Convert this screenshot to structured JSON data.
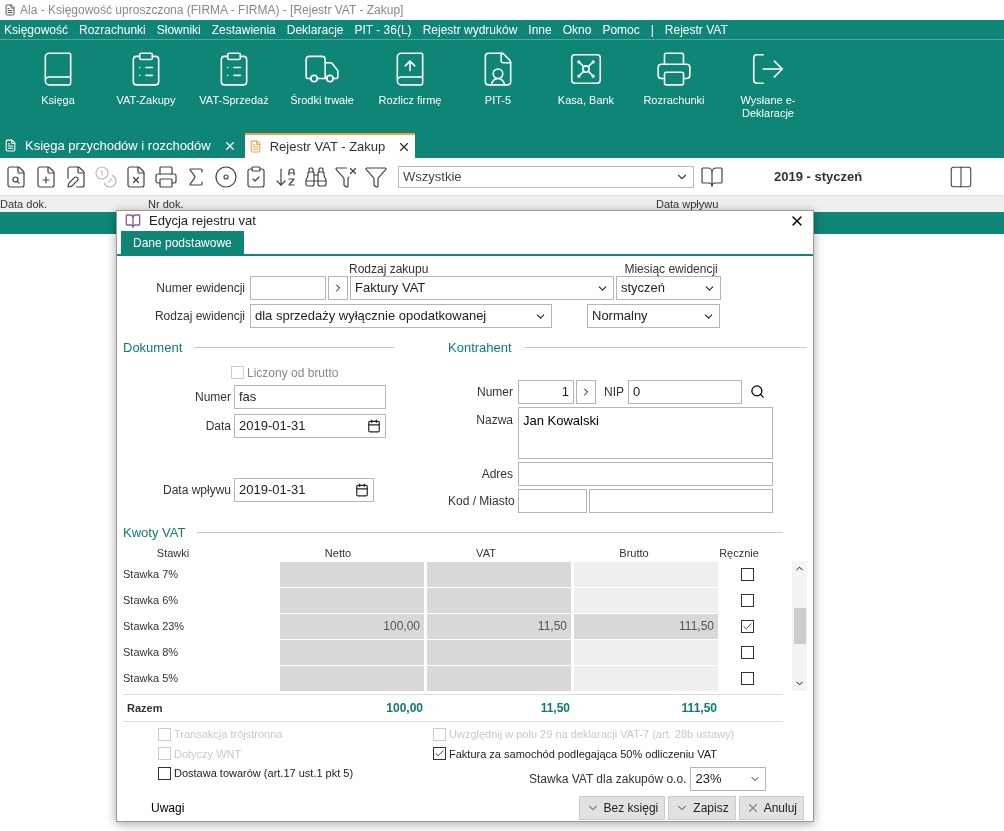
{
  "window": {
    "title": "Ala - Księgowość uproszczona (FIRMA - FIRMA) - [Rejestr VAT - Zakup]"
  },
  "menu": [
    "Księgowość",
    "Rozrachunki",
    "Słowniki",
    "Zestawienia",
    "Deklaracje",
    "PIT - 36(L)",
    "Rejestr wydruków",
    "Inne",
    "Okno",
    "Pomoc",
    "|",
    "Rejestr VAT"
  ],
  "ribbon": [
    {
      "label": "Księga"
    },
    {
      "label": "VAT-Zakupy"
    },
    {
      "label": "VAT-Sprzedaż"
    },
    {
      "label": "Środki trwałe"
    },
    {
      "label": "Rozlicz firmę"
    },
    {
      "label": "PIT-5"
    },
    {
      "label": "Kasa, Bank"
    },
    {
      "label": "Rozrachunki"
    },
    {
      "label": "Wysłane e-Deklaracje"
    }
  ],
  "doc_tabs": [
    {
      "label": "Księga przychodów i rozchodów",
      "selected": false
    },
    {
      "label": "Rejestr VAT - Zakup",
      "selected": true
    }
  ],
  "toolbar": {
    "filter": "Wszystkie",
    "period": "2019 - styczeń"
  },
  "columns": [
    "Data dok.",
    "Nr dok.",
    "Data wpływu"
  ],
  "dialog": {
    "title": "Edycja rejestru vat",
    "tab": {
      "label": "Dane podstawowe",
      "selected": true
    },
    "rodzaj_zakupu_label": "Rodzaj zakupu",
    "miesiac_label": "Miesiąc ewidencji",
    "numer_ewidencji_label": "Numer ewidencji",
    "rodzaj_zakupu": "Faktury VAT",
    "miesiac": "styczeń",
    "rodzaj_ewidencji_label": "Rodzaj ewidencji",
    "rodzaj_ewidencji": "dla sprzedaży wyłącznie opodatkowanej",
    "tryb": "Normalny",
    "dokument": {
      "heading": "Dokument",
      "brutto_label": "Liczony od brutto",
      "brutto_checked": false,
      "numer_label": "Numer",
      "numer": "fas",
      "data_label": "Data",
      "data": "2019-01-31",
      "wplyw_label": "Data wpływu",
      "wplyw": "2019-01-31"
    },
    "kontrahent": {
      "heading": "Kontrahent",
      "numer_label": "Numer",
      "numer": "1",
      "nip_label": "NIP",
      "nip": "0",
      "nazwa_label": "Nazwa",
      "nazwa": "Jan Kowalski",
      "adres_label": "Adres",
      "kod_label": "Kod / Miasto"
    },
    "kwoty": {
      "heading": "Kwoty VAT",
      "columns": [
        "Stawki",
        "Netto",
        "VAT",
        "Brutto",
        "Ręcznie"
      ],
      "rows": [
        {
          "label": "Stawka 7%",
          "netto": "",
          "vat": "",
          "brutto": "",
          "checked": false
        },
        {
          "label": "Stawka 6%",
          "netto": "",
          "vat": "",
          "brutto": "",
          "checked": false
        },
        {
          "label": "Stawka 23%",
          "netto": "100,00",
          "vat": "11,50",
          "brutto": "111,50",
          "checked": true
        },
        {
          "label": "Stawka 8%",
          "netto": "",
          "vat": "",
          "brutto": "",
          "checked": false
        },
        {
          "label": "Stawka 5%",
          "netto": "",
          "vat": "",
          "brutto": "",
          "checked": false
        }
      ],
      "total_label": "Razem",
      "total_netto": "100,00",
      "total_vat": "11,50",
      "total_brutto": "111,50"
    },
    "options_left": [
      {
        "label": "Transakcja trójstronna",
        "checked": false,
        "disabled": true
      },
      {
        "label": "Dotyczy WNT",
        "checked": false,
        "disabled": true
      },
      {
        "label": "Dostawa towarów (art.17 ust.1 pkt 5)",
        "checked": false,
        "disabled": false
      }
    ],
    "options_right": [
      {
        "label": "Uwzględnij w polu 29 na deklaracji VAT-7 (art. 28b ustawy)",
        "checked": false,
        "disabled": true
      },
      {
        "label": "Faktura za samochód podlegająca 50% odliczeniu VAT",
        "checked": true,
        "disabled": false
      }
    ],
    "stawka_label": "Stawka VAT dla zakupów o.o.",
    "stawka": "23%",
    "uwagi": "Uwagi",
    "buttons": [
      "Bez księgi",
      "Zapisz",
      "Anuluj"
    ]
  }
}
